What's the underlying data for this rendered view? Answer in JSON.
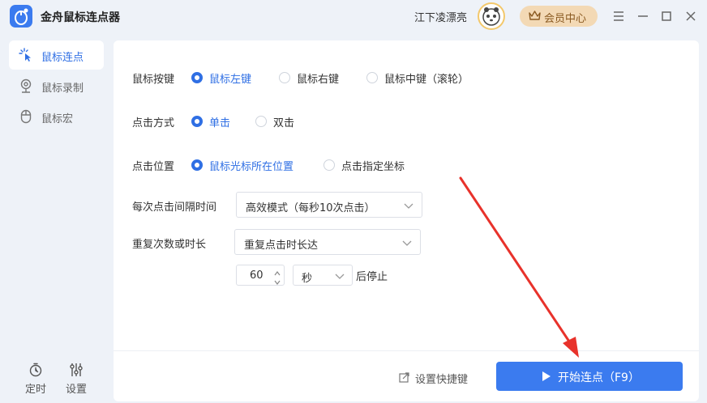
{
  "app": {
    "title": "金舟鼠标连点器",
    "username": "江下凌漂亮",
    "vip_label": "会员中心"
  },
  "sidebar": {
    "items": [
      {
        "label": "鼠标连点",
        "icon": "cursor-click-icon",
        "active": true
      },
      {
        "label": "鼠标录制",
        "icon": "record-icon",
        "active": false
      },
      {
        "label": "鼠标宏",
        "icon": "mouse-icon",
        "active": false
      }
    ],
    "bottom": [
      {
        "label": "定时",
        "icon": "timer-icon"
      },
      {
        "label": "设置",
        "icon": "sliders-icon"
      }
    ]
  },
  "settings": {
    "mouse_button": {
      "label": "鼠标按键",
      "options": [
        "鼠标左键",
        "鼠标右键",
        "鼠标中键（滚轮）"
      ],
      "selected": 0
    },
    "click_mode": {
      "label": "点击方式",
      "options": [
        "单击",
        "双击"
      ],
      "selected": 0
    },
    "click_position": {
      "label": "点击位置",
      "options": [
        "鼠标光标所在位置",
        "点击指定坐标"
      ],
      "selected": 0
    },
    "interval": {
      "label": "每次点击间隔时间",
      "value": "高效模式（每秒10次点击）"
    },
    "repeat": {
      "label": "重复次数或时长",
      "value": "重复点击时长达",
      "amount": "60",
      "unit": "秒",
      "suffix": "后停止"
    }
  },
  "footer": {
    "shortcut_label": "设置快捷键",
    "start_label": "开始连点（F9）"
  },
  "colors": {
    "accent": "#2f6fe4",
    "button": "#3b7bef",
    "annotation_arrow": "#e8322b"
  }
}
